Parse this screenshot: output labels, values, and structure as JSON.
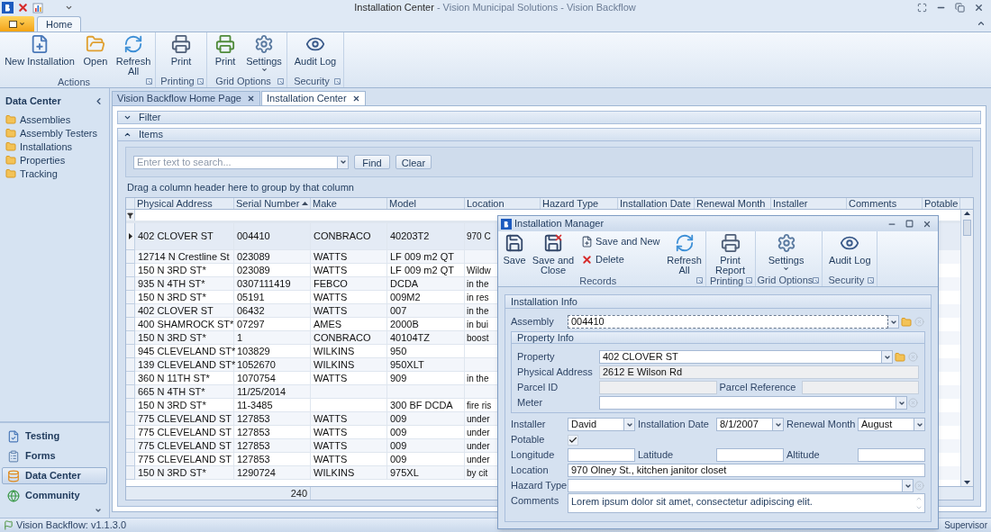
{
  "window": {
    "title": "Installation Center",
    "title_suffix": "- Vision Municipal Solutions - Vision Backflow"
  },
  "ribbon": {
    "tabs": [
      {
        "label": "Home",
        "selected": true
      }
    ],
    "groups": [
      {
        "label": "Actions",
        "buttons": [
          {
            "label": "New Installation",
            "kind": "large"
          },
          {
            "label": "Open",
            "kind": "large"
          },
          {
            "label": "Refresh All",
            "kind": "large"
          }
        ]
      },
      {
        "label": "Printing",
        "buttons": [
          {
            "label": "Print",
            "kind": "large"
          }
        ]
      },
      {
        "label": "Grid Options",
        "buttons": [
          {
            "label": "Print",
            "kind": "large"
          },
          {
            "label": "Settings",
            "kind": "large",
            "dropdown": true
          }
        ]
      },
      {
        "label": "Security",
        "buttons": [
          {
            "label": "Audit Log",
            "kind": "large"
          }
        ]
      }
    ]
  },
  "sidebar": {
    "title": "Data Center",
    "items": [
      "Assemblies",
      "Assembly Testers",
      "Installations",
      "Properties",
      "Tracking"
    ],
    "nav": [
      {
        "label": "Testing",
        "selected": false
      },
      {
        "label": "Forms",
        "selected": false
      },
      {
        "label": "Data Center",
        "selected": true
      },
      {
        "label": "Community",
        "selected": false
      }
    ]
  },
  "document_tabs": [
    {
      "label": "Vision Backflow Home Page",
      "selected": false
    },
    {
      "label": "Installation Center",
      "selected": true
    }
  ],
  "filter_panel": {
    "label": "Filter",
    "expanded": false
  },
  "items_panel": {
    "label": "Items",
    "expanded": true
  },
  "search": {
    "placeholder": "Enter text to search...",
    "buttons": [
      "Find",
      "Clear"
    ]
  },
  "group_hint": "Drag a column header here to group by that column",
  "grid": {
    "columns": [
      {
        "label": "Physical Address",
        "sorted": false
      },
      {
        "label": "Serial Number",
        "sorted": true
      },
      {
        "label": "Make",
        "sorted": false
      },
      {
        "label": "Model",
        "sorted": false
      },
      {
        "label": "Location",
        "sorted": false
      },
      {
        "label": "Hazard Type",
        "sorted": false
      },
      {
        "label": "Installation Date",
        "sorted": false
      },
      {
        "label": "Renewal Month",
        "sorted": false
      },
      {
        "label": "Installer",
        "sorted": false
      },
      {
        "label": "Comments",
        "sorted": false
      },
      {
        "label": "Potable",
        "sorted": false
      }
    ],
    "rows": [
      {
        "selected": true,
        "physical_address": "402 CLOVER ST",
        "serial_number": "004410",
        "make": "CONBRACO",
        "model": "40203T2",
        "location": "970 C"
      },
      {
        "selected": false,
        "physical_address": "12714 N Crestline St",
        "serial_number": "023089",
        "make": "WATTS",
        "model": "LF 009 m2 QT"
      },
      {
        "selected": false,
        "physical_address": "150 N 3RD ST*",
        "serial_number": "023089",
        "make": "WATTS",
        "model": "LF 009 m2 QT",
        "location": "Wildw"
      },
      {
        "selected": false,
        "physical_address": "935 N 4TH ST*",
        "serial_number": "0307111419",
        "make": "FEBCO",
        "model": "DCDA",
        "location": "in the"
      },
      {
        "selected": false,
        "physical_address": "150 N 3RD ST*",
        "serial_number": "05191",
        "make": "WATTS",
        "model": "009M2",
        "location": "in res"
      },
      {
        "selected": false,
        "physical_address": "402 CLOVER ST",
        "serial_number": "06432",
        "make": "WATTS",
        "model": "007",
        "location": "in the"
      },
      {
        "selected": false,
        "physical_address": "400 SHAMROCK ST*",
        "serial_number": "07297",
        "make": "AMES",
        "model": "2000B",
        "location": "in bui"
      },
      {
        "selected": false,
        "physical_address": "150 N 3RD ST*",
        "serial_number": "1",
        "make": "CONBRACO",
        "model": "40104TZ",
        "location": "boost"
      },
      {
        "selected": false,
        "physical_address": "945 CLEVELAND ST*",
        "serial_number": "103829",
        "make": "WILKINS",
        "model": "950"
      },
      {
        "selected": false,
        "physical_address": "139 CLEVELAND ST*",
        "serial_number": "1052670",
        "make": "WILKINS",
        "model": "950XLT"
      },
      {
        "selected": false,
        "physical_address": "360 N 11TH ST*",
        "serial_number": "1070754",
        "make": "WATTS",
        "model": "909",
        "location": "in the"
      },
      {
        "selected": false,
        "physical_address": "665 N 4TH ST*",
        "serial_number": "11/25/2014"
      },
      {
        "selected": false,
        "physical_address": "150 N 3RD ST*",
        "serial_number": "11-3485",
        "model": "300 BF DCDA",
        "location": "fire ris"
      },
      {
        "selected": false,
        "physical_address": "775 CLEVELAND ST",
        "serial_number": "127853",
        "make": "WATTS",
        "model": "009",
        "location": "under"
      },
      {
        "selected": false,
        "physical_address": "775 CLEVELAND ST",
        "serial_number": "127853",
        "make": "WATTS",
        "model": "009",
        "location": "under"
      },
      {
        "selected": false,
        "physical_address": "775 CLEVELAND ST",
        "serial_number": "127853",
        "make": "WATTS",
        "model": "009",
        "location": "under"
      },
      {
        "selected": false,
        "physical_address": "775 CLEVELAND ST",
        "serial_number": "127853",
        "make": "WATTS",
        "model": "009",
        "location": "under"
      },
      {
        "selected": false,
        "physical_address": "150 N 3RD ST*",
        "serial_number": "1290724",
        "make": "WILKINS",
        "model": "975XL",
        "location": "by cit"
      }
    ],
    "footer_count": "240"
  },
  "installation_manager": {
    "title": "Installation Manager",
    "ribbon": {
      "groups": [
        {
          "label": "Records",
          "buttons": [
            {
              "label": "Save",
              "kind": "large"
            },
            {
              "label": "Save and Close",
              "kind": "large"
            },
            {
              "label": "Save and New",
              "kind": "small"
            },
            {
              "label": "Delete",
              "kind": "small"
            },
            {
              "label": "Refresh All",
              "kind": "large"
            }
          ]
        },
        {
          "label": "Printing",
          "buttons": [
            {
              "label": "Print Report",
              "kind": "large"
            }
          ]
        },
        {
          "label": "Grid Options",
          "buttons": [
            {
              "label": "Settings",
              "kind": "large",
              "dropdown": true
            }
          ]
        },
        {
          "label": "Security",
          "buttons": [
            {
              "label": "Audit Log",
              "kind": "large"
            }
          ]
        }
      ]
    },
    "form": {
      "title": "Installation Info",
      "assembly": {
        "label": "Assembly",
        "value": "004410",
        "kind": "lookup",
        "focused": true
      },
      "property_info": {
        "title": "Property Info",
        "rows": [
          [
            {
              "label": "Property",
              "value": "402 CLOVER ST",
              "kind": "lookup"
            }
          ],
          [
            {
              "label": "Physical Address",
              "value": "2612 E Wilson Rd",
              "kind": "readonly"
            }
          ],
          [
            {
              "label": "Parcel ID",
              "kind": "readonly"
            },
            {
              "label": "Parcel Reference",
              "kind": "readonly"
            }
          ],
          [
            {
              "label": "Meter",
              "kind": "combo"
            }
          ]
        ]
      },
      "rows": [
        [
          {
            "label": "Installer",
            "value": "David",
            "kind": "dropdown"
          },
          {
            "label": "Installation Date",
            "value": "8/1/2007",
            "kind": "dropdown"
          },
          {
            "label": "Renewal Month",
            "value": "August",
            "kind": "dropdown"
          }
        ],
        [
          {
            "label": "Potable",
            "kind": "checkbox",
            "checked": true
          }
        ],
        [
          {
            "label": "Longitude",
            "kind": "text"
          },
          {
            "label": "Latitude",
            "kind": "text"
          },
          {
            "label": "Altitude",
            "kind": "text"
          }
        ],
        [
          {
            "label": "Location",
            "value": "970 Olney St., kitchen janitor closet",
            "kind": "text"
          }
        ],
        [
          {
            "label": "Hazard Type",
            "kind": "combo"
          }
        ],
        [
          {
            "label": "Comments",
            "value": "Lorem ipsum dolor sit amet, consectetur adipiscing elit.",
            "kind": "memo"
          }
        ]
      ]
    }
  },
  "status_bar": {
    "version": "Vision Backflow: v1.1.3.0",
    "user": "Supervisor"
  }
}
